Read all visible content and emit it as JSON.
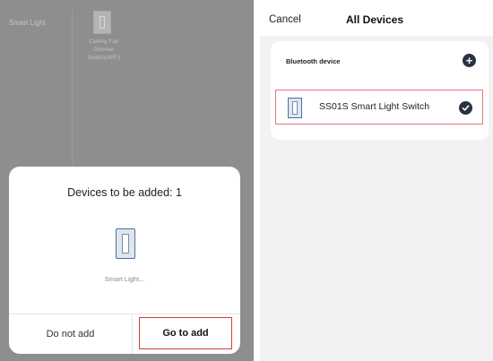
{
  "left_screen": {
    "background": {
      "category_label": "Smart Light",
      "device_name": "Ceiling Fan\nDimmer\nSwitch(WiFi)"
    },
    "dialog": {
      "title": "Devices to be added: 1",
      "device_label": "Smart Light...",
      "do_not_add_label": "Do not add",
      "go_to_add_label": "Go to add"
    }
  },
  "right_screen": {
    "nav": {
      "cancel_label": "Cancel",
      "title": "All Devices"
    },
    "section": {
      "label": "Bluetooth device",
      "add_icon": "plus-circle-icon"
    },
    "devices": [
      {
        "name": "SS01S Smart Light Switch",
        "selected": true,
        "icon": "light-switch-icon"
      }
    ]
  },
  "colors": {
    "overlay_gray": "#8e8e8e",
    "accent_dark": "#2a3140",
    "highlight_red": "#d33b3b",
    "page_background": "#f2f2f4"
  }
}
